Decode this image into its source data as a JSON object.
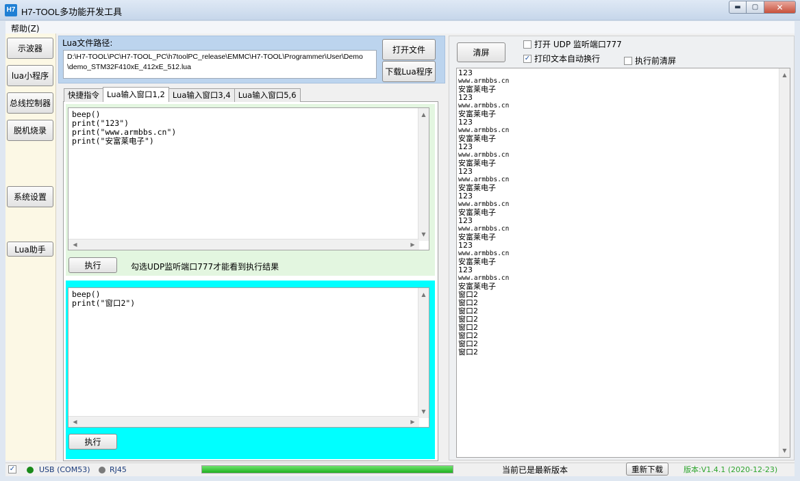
{
  "window": {
    "icon_text": "H7",
    "title": "H7-TOOL多功能开发工具",
    "min_glyph": "▬",
    "max_glyph": "▢",
    "close_glyph": "✕"
  },
  "menu": {
    "help": "帮助(Z)"
  },
  "nav": {
    "oscilloscope": "示波器",
    "lua_app": "lua小程序",
    "bus_controller": "总线控制器",
    "offline_burn": "脱机烧录",
    "system_settings": "系统设置",
    "lua_assistant": "Lua助手"
  },
  "lua_file": {
    "label": "Lua文件路径:",
    "path_line1": "D:\\H7-TOOL\\PC\\H7-TOOL_PC\\h7toolPC_release\\EMMC\\H7-TOOL\\Programmer\\User\\Demo",
    "path_line2": "\\demo_STM32F410xE_412xE_512.lua",
    "open_button": "打开文件",
    "download_button": "下载Lua程序"
  },
  "tabs": [
    {
      "label": "快捷指令"
    },
    {
      "label": "Lua输入窗口1,2"
    },
    {
      "label": "Lua输入窗口3,4"
    },
    {
      "label": "Lua输入窗口5,6"
    }
  ],
  "editor1": {
    "code": "beep()\nprint(\"123\")\nprint(\"www.armbbs.cn\")\nprint(\"安富莱电子\")",
    "run_button": "执行",
    "hint": "勾选UDP监听端口777才能看到执行结果"
  },
  "editor2": {
    "code": "beep()\nprint(\"窗口2\")",
    "run_button": "执行"
  },
  "right": {
    "clear_button": "清屏",
    "udp_checkbox": {
      "label": "打开 UDP 监听端口777",
      "checked": false
    },
    "wrap_checkbox": {
      "label": "打印文本自动换行",
      "checked": true
    },
    "clear_before_checkbox": {
      "label": "执行前清屏",
      "checked": false
    },
    "check_glyph": "✓",
    "output_lines": [
      "123",
      "www.armbbs.cn",
      "安富莱电子",
      "123",
      "www.armbbs.cn",
      "安富莱电子",
      "123",
      "www.armbbs.cn",
      "安富莱电子",
      "123",
      "www.armbbs.cn",
      "安富莱电子",
      "123",
      "www.armbbs.cn",
      "安富莱电子",
      "123",
      "www.armbbs.cn",
      "安富莱电子",
      "123",
      "www.armbbs.cn",
      "安富莱电子",
      "123",
      "www.armbbs.cn",
      "安富莱电子",
      "123",
      "www.armbbs.cn",
      "安富莱电子",
      "窗口2",
      "窗口2",
      "窗口2",
      "窗口2",
      "窗口2",
      "窗口2",
      "窗口2",
      "窗口2"
    ]
  },
  "status": {
    "check_glyph": "✓",
    "usb_label": "USB (COM53)",
    "usb_color": "#1a8a1a",
    "rj45_label": "RJ45",
    "rj45_color": "#7a7a7a",
    "progress": 1.0,
    "update_text": "当前已是最新版本",
    "redownload_button": "重新下载",
    "version_text": "版本:V1.4.1 (2020-12-23)",
    "version_color": "#2ea52e"
  }
}
